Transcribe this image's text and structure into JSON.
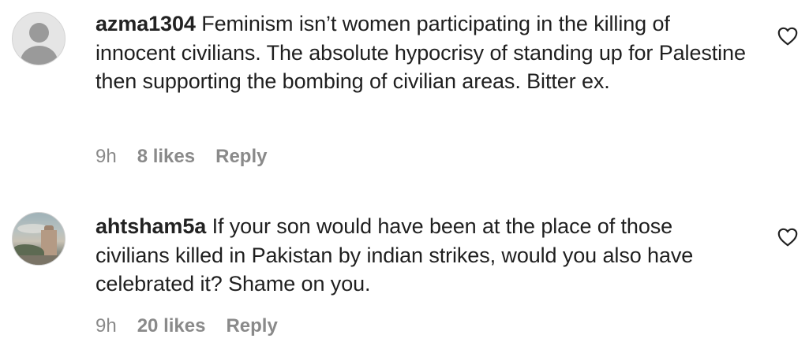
{
  "comments": [
    {
      "username": "azma1304",
      "text": "Feminism isn’t women participating in the killing of innocent civilians. The absolute hypocrisy of standing up for Palestine then supporting the bombing of civilian areas. Bitter ex.",
      "time": "9h",
      "likes": "8 likes",
      "reply_label": "Reply",
      "avatar_icon": "default-profile-icon",
      "like_icon": "heart-outline-icon"
    },
    {
      "username": "ahtsham5a",
      "text": "If your son would have been at the place of those civilians killed in Pakistan by indian strikes, would you also have celebrated it? Shame on you.",
      "time": "9h",
      "likes": "20 likes",
      "reply_label": "Reply",
      "avatar_icon": "profile-photo",
      "like_icon": "heart-outline-icon"
    }
  ],
  "colors": {
    "text": "#1f1f1f",
    "meta": "#8a8a8a",
    "icon": "#222222"
  }
}
